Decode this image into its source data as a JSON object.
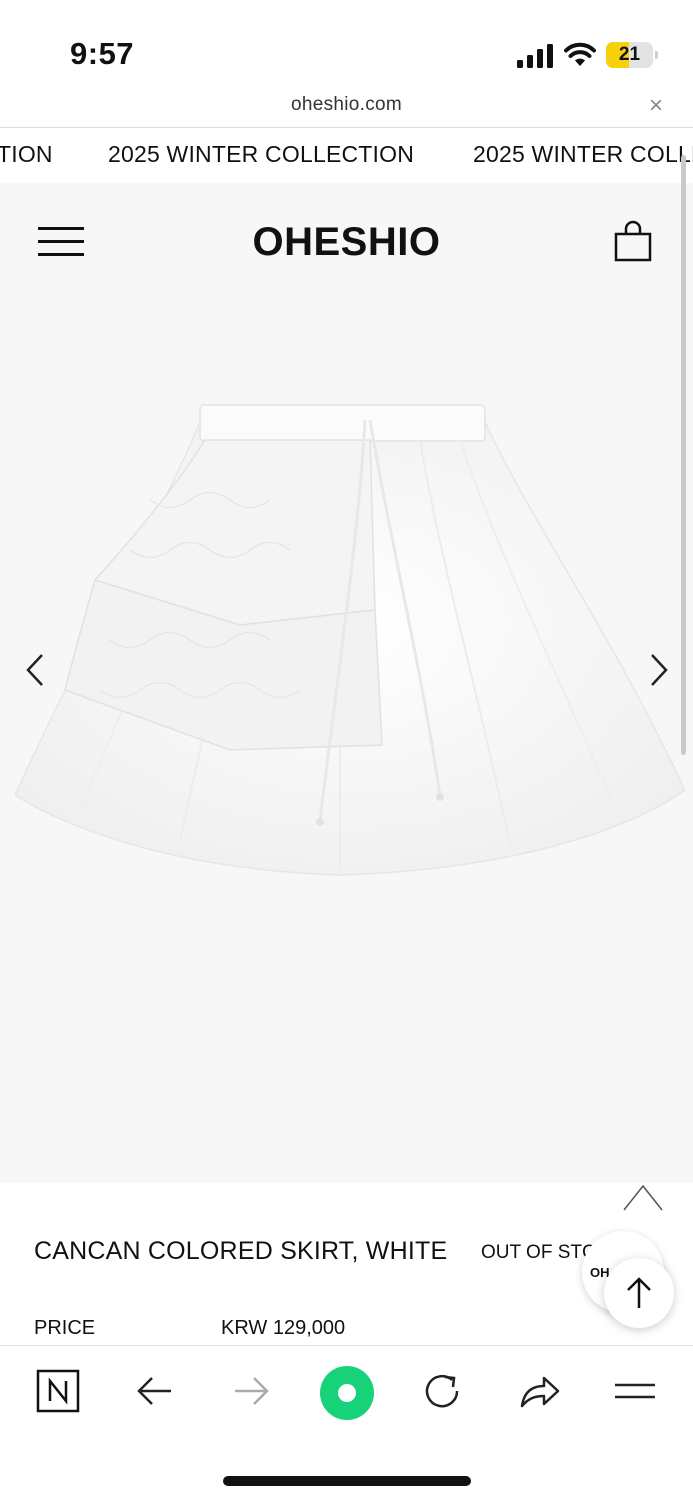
{
  "status_bar": {
    "time": "9:57",
    "battery": "21",
    "battery_level": 0.21
  },
  "browser": {
    "url": "oheshio.com",
    "close_label": "×"
  },
  "announcement": {
    "items": [
      "TION",
      "2025 WINTER COLLECTION",
      "2025 WINTER COLLE"
    ]
  },
  "header": {
    "logo": "OHESHIO"
  },
  "product": {
    "name": "CANCAN COLORED SKIRT, WHITE",
    "stock_status": "OUT OF STC",
    "price_label": "PRICE",
    "price": "KRW 129,000"
  },
  "chat_badge": {
    "label": "OH"
  },
  "colors": {
    "accent_green": "#18d27a",
    "battery_yellow": "#f7d10a",
    "page_bg": "#f7f7f7"
  }
}
